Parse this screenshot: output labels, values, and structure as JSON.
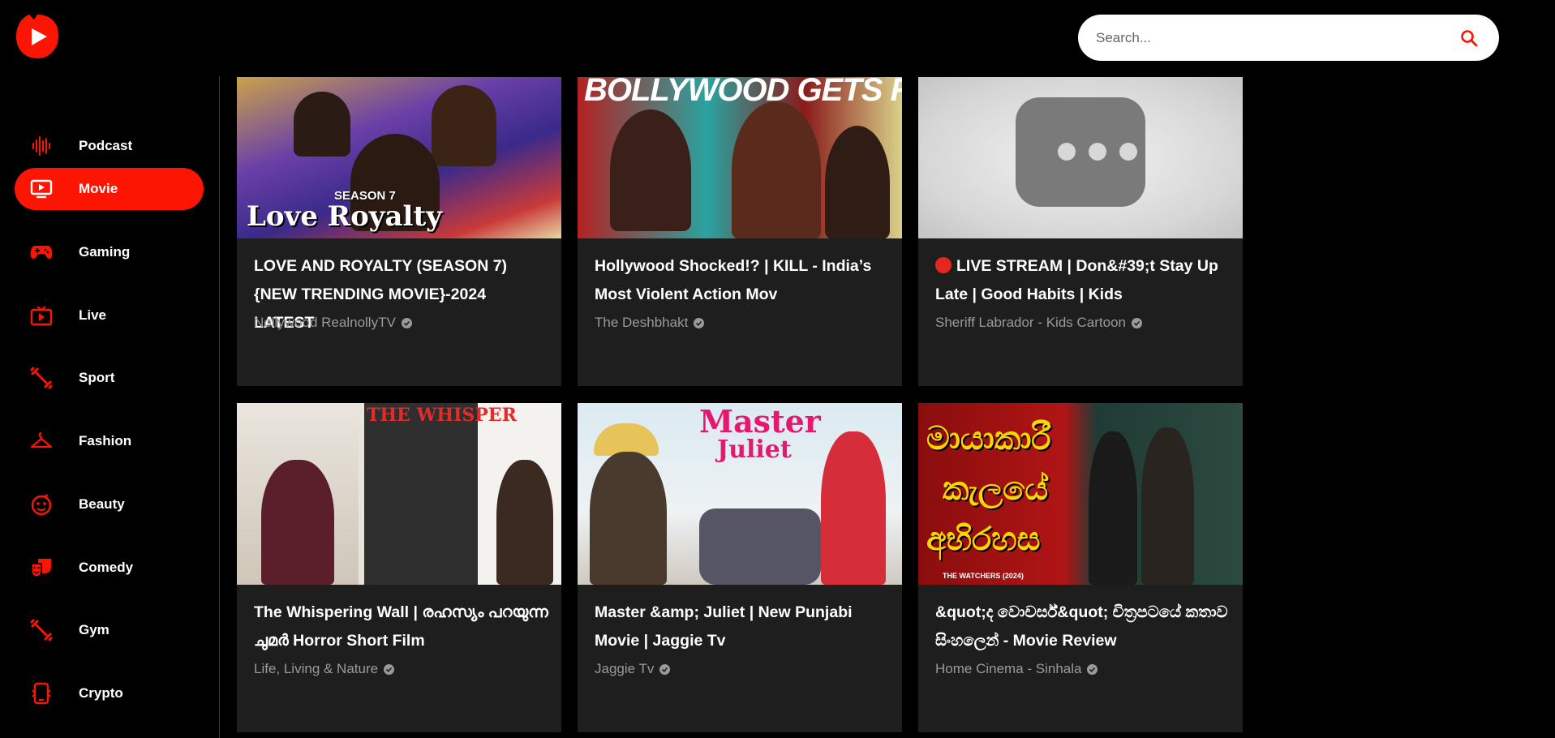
{
  "header": {
    "logo_icon": "play-logo-icon",
    "search": {
      "placeholder": "Search...",
      "icon": "search-icon"
    }
  },
  "colors": {
    "accent": "#fc1503",
    "background": "#000000",
    "card": "#1e1e1e",
    "channel_text": "#9a9a9a"
  },
  "sidebar": {
    "items": [
      {
        "label": "Podcast",
        "icon": "sound-wave-icon",
        "active": false
      },
      {
        "label": "Movie",
        "icon": "tv-play-icon",
        "active": true
      },
      {
        "label": "Gaming",
        "icon": "gamepad-icon",
        "active": false
      },
      {
        "label": "Live",
        "icon": "live-tv-icon",
        "active": false
      },
      {
        "label": "Sport",
        "icon": "dumbbell-icon",
        "active": false
      },
      {
        "label": "Fashion",
        "icon": "hanger-icon",
        "active": false
      },
      {
        "label": "Beauty",
        "icon": "face-icon",
        "active": false
      },
      {
        "label": "Comedy",
        "icon": "theater-masks-icon",
        "active": false
      },
      {
        "label": "Gym",
        "icon": "dumbbell-icon",
        "active": false
      },
      {
        "label": "Crypto",
        "icon": "crypto-phone-icon",
        "active": false
      }
    ]
  },
  "videos": [
    {
      "title": "LOVE AND ROYALTY (SEASON 7){NEW TRENDING MOVIE}-2024 LATEST",
      "channel": "Nollywood RealnollyTV",
      "verified": true,
      "thumb_text": [
        "SEASON 7",
        "Love Royalty"
      ]
    },
    {
      "title": "Hollywood Shocked!? | KILL - India’s Most Violent Action Mov",
      "channel": "The Deshbhakt",
      "verified": true,
      "thumb_text": [
        "BOLLYWOOD GETS RE"
      ]
    },
    {
      "title": "LIVE STREAM | Don&#39;t Stay Up Late | Good Habits | Kids",
      "channel": "Sheriff Labrador - Kids Cartoon",
      "verified": true,
      "live": true,
      "thumb_text": []
    },
    {
      "title": "The Whispering Wall | രഹസ്യം പറയുന്ന ചുമർ Horror Short Film",
      "channel": "Life, Living & Nature",
      "verified": true,
      "thumb_text": [
        "THE WHISPER"
      ]
    },
    {
      "title": "Master &amp; Juliet | New Punjabi Movie | Jaggie Tv",
      "channel": "Jaggie Tv",
      "verified": true,
      "thumb_text": [
        "Master",
        "Juliet"
      ]
    },
    {
      "title": "&quot;ද වොචර්ස්&quot; චිත්‍රපටයේ කතාව සිංහලෙන් - Movie Review",
      "channel": "Home Cinema - Sinhala",
      "verified": true,
      "thumb_text": [
        "මායාකාරී",
        "කැලයේ",
        "අභිරහස",
        "THE WATCHERS (2024)"
      ]
    }
  ]
}
